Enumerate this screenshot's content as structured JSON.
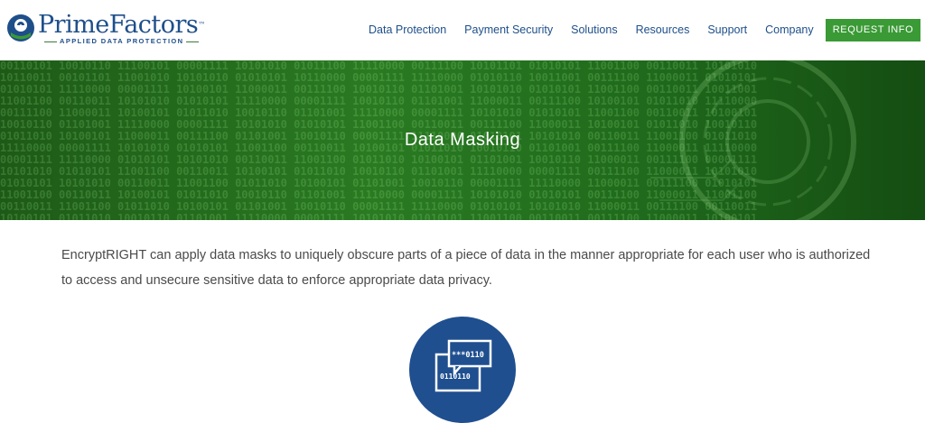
{
  "logo": {
    "name": "PrimeFactors",
    "tm": "™",
    "tagline": "APPLIED DATA PROTECTION"
  },
  "nav": {
    "items": [
      "Data Protection",
      "Payment Security",
      "Solutions",
      "Resources",
      "Support",
      "Company"
    ],
    "cta": "REQUEST INFO"
  },
  "hero": {
    "title": "Data Masking"
  },
  "main": {
    "intro": "EncryptRIGHT can apply data masks to uniquely obscure parts of a piece of data in the manner appropriate for each user who is authorized to access and unsecure sensitive data to enforce appropriate data privacy.",
    "icon": {
      "top_text": "***0110",
      "bottom_text": "0110110"
    }
  },
  "colors": {
    "brand_blue": "#1e4f8a",
    "cta_green": "#3a9a35",
    "hero_green": "#2a7a22",
    "icon_circle": "#1f4f8f"
  }
}
